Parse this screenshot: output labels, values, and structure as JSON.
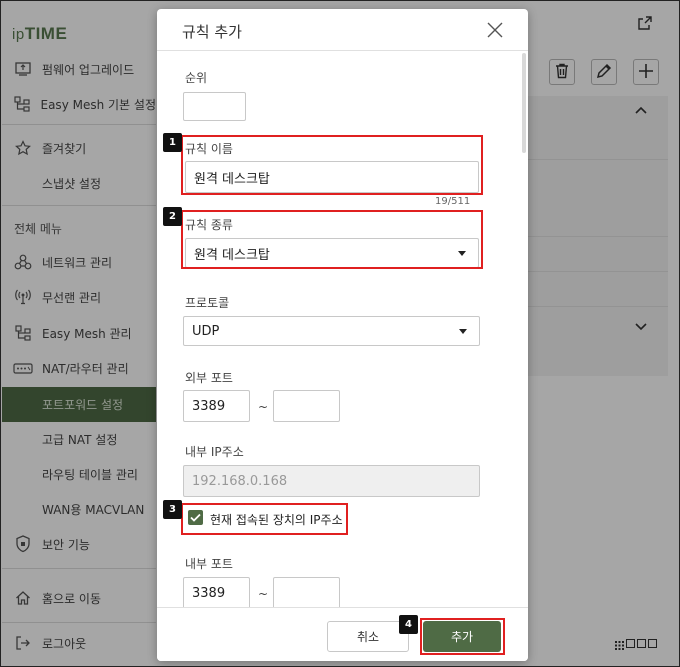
{
  "app": {
    "logo_prefix": "ip",
    "logo_main": "TIME"
  },
  "sidebar": {
    "items_top": [
      {
        "label": "펌웨어 업그레이드",
        "icon": "firmware-icon"
      },
      {
        "label": "Easy Mesh 기본 설정",
        "icon": "mesh-icon"
      }
    ],
    "favorites": {
      "label": "즐겨찾기",
      "icon": "star-icon"
    },
    "snapshot": "스냅샷 설정",
    "section_title": "전체 메뉴",
    "menu": [
      {
        "label": "네트워크 관리",
        "icon": "network-icon"
      },
      {
        "label": "무선랜 관리",
        "icon": "wifi-icon"
      },
      {
        "label": "Easy Mesh 관리",
        "icon": "mesh-icon"
      },
      {
        "label": "NAT/라우터 관리",
        "icon": "router-icon"
      }
    ],
    "sub_menu": [
      "포트포워드 설정",
      "고급 NAT 설정",
      "라우팅 테이블 관리",
      "WAN용 MACVLAN"
    ],
    "active_sub": "포트포워드 설정",
    "security": {
      "label": "보안 기능",
      "icon": "shield-icon"
    },
    "home": {
      "label": "홈으로 이동",
      "icon": "home-icon"
    },
    "logout": {
      "label": "로그아웃",
      "icon": "logout-icon"
    }
  },
  "modal": {
    "title": "규칙 추가",
    "fields": {
      "priority": {
        "label": "순위",
        "value": ""
      },
      "rule_name": {
        "label": "규칙 이름",
        "value": "원격 데스크탑",
        "counter": "19/511"
      },
      "rule_type": {
        "label": "규칙 종류",
        "value": "원격 데스크탑"
      },
      "protocol": {
        "label": "프로토콜",
        "value": "UDP"
      },
      "external_port": {
        "label": "외부 포트",
        "from": "3389",
        "to": "",
        "sep": "~"
      },
      "internal_ip": {
        "label": "내부 IP주소",
        "value": "192.168.0.168"
      },
      "use_current_ip": {
        "label": "현재 접속된 장치의 IP주소",
        "checked": true
      },
      "internal_port": {
        "label": "내부 포트",
        "from": "3389",
        "to": "",
        "sep": "~"
      }
    },
    "buttons": {
      "cancel": "취소",
      "add": "추가"
    }
  },
  "badges": [
    "1",
    "2",
    "3",
    "4"
  ],
  "colors": {
    "accent": "#4f6b45",
    "highlight": "#e02020"
  }
}
